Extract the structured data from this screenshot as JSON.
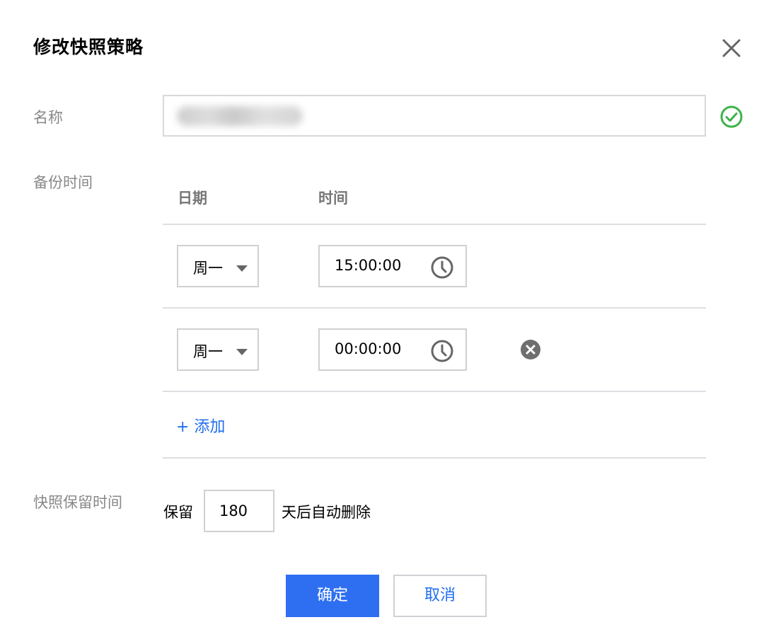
{
  "dialog": {
    "title": "修改快照策略"
  },
  "form": {
    "name": {
      "label": "名称"
    },
    "backup_time": {
      "label": "备份时间",
      "columns": {
        "date": "日期",
        "time": "时间"
      },
      "rows": [
        {
          "day": "周一",
          "time": "15:00:00",
          "removable": false
        },
        {
          "day": "周一",
          "time": "00:00:00",
          "removable": true
        }
      ],
      "add_label": "+ 添加"
    },
    "retention": {
      "label": "快照保留时间",
      "prefix": "保留",
      "days": "180",
      "suffix": "天后自动删除"
    }
  },
  "footer": {
    "confirm_label": "确定",
    "cancel_label": "取消"
  },
  "icons": {
    "close": "close-icon",
    "valid": "check-circle-icon",
    "clock": "clock-icon",
    "remove": "remove-circle-icon",
    "caret": "caret-down-icon"
  },
  "colors": {
    "primary": "#2e6ff2",
    "link": "#1f6ef0",
    "success": "#3cb34a",
    "muted_label": "#888888"
  }
}
